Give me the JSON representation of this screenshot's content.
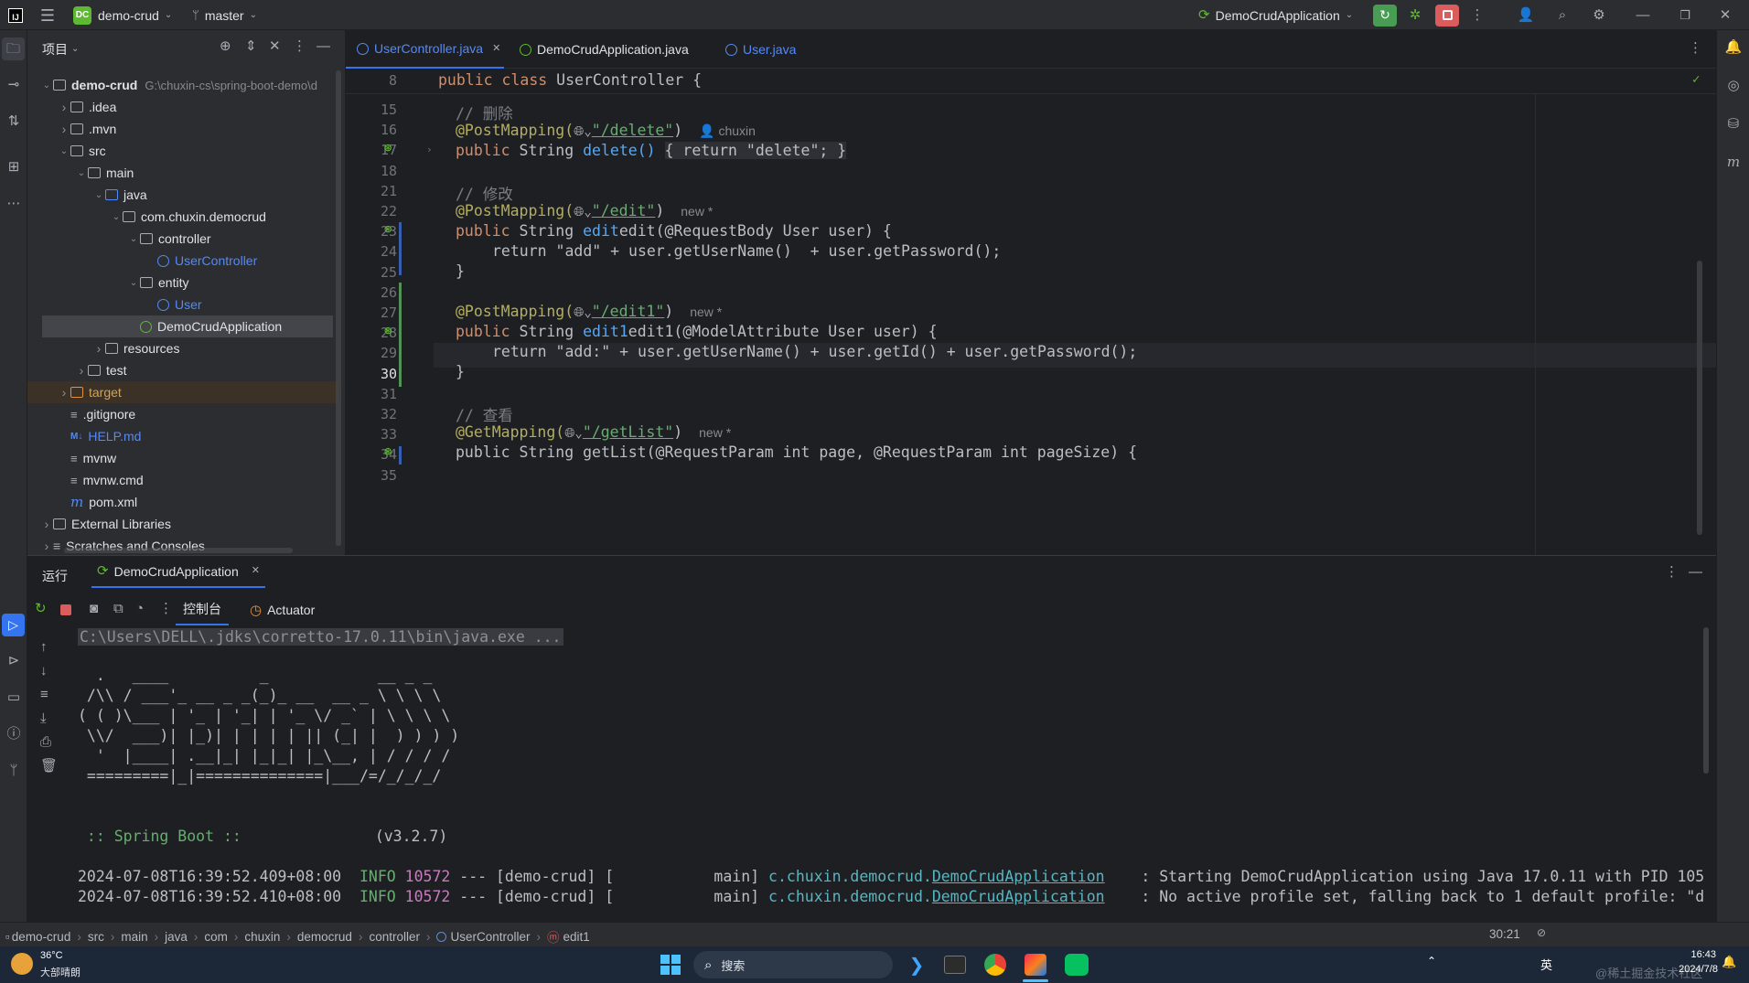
{
  "titlebar": {
    "project_badge": "DC",
    "project_name": "demo-crud",
    "branch": "master",
    "run_config": "DemoCrudApplication"
  },
  "project_panel": {
    "title": "项目",
    "items": [
      {
        "label": "demo-crud",
        "path": "G:\\chuxin-cs\\spring-boot-demo\\d",
        "depth": 0,
        "type": "module",
        "expanded": true
      },
      {
        "label": ".idea",
        "depth": 1,
        "type": "folder",
        "expanded": false
      },
      {
        "label": ".mvn",
        "depth": 1,
        "type": "folder",
        "expanded": false
      },
      {
        "label": "src",
        "depth": 1,
        "type": "folder",
        "expanded": true
      },
      {
        "label": "main",
        "depth": 2,
        "type": "folder",
        "expanded": true
      },
      {
        "label": "java",
        "depth": 3,
        "type": "source-folder",
        "expanded": true
      },
      {
        "label": "com.chuxin.democrud",
        "depth": 4,
        "type": "package",
        "expanded": true
      },
      {
        "label": "controller",
        "depth": 5,
        "type": "package",
        "expanded": true
      },
      {
        "label": "UserController",
        "depth": 6,
        "type": "class"
      },
      {
        "label": "entity",
        "depth": 5,
        "type": "package",
        "expanded": true
      },
      {
        "label": "User",
        "depth": 6,
        "type": "class"
      },
      {
        "label": "DemoCrudApplication",
        "depth": 5,
        "type": "spring-class",
        "selected": true
      },
      {
        "label": "resources",
        "depth": 3,
        "type": "folder",
        "expanded": false
      },
      {
        "label": "test",
        "depth": 2,
        "type": "folder",
        "expanded": false
      },
      {
        "label": "target",
        "depth": 1,
        "type": "excluded-folder",
        "expanded": false
      },
      {
        "label": ".gitignore",
        "depth": 1,
        "type": "file"
      },
      {
        "label": "HELP.md",
        "depth": 1,
        "type": "markdown"
      },
      {
        "label": "mvnw",
        "depth": 1,
        "type": "file"
      },
      {
        "label": "mvnw.cmd",
        "depth": 1,
        "type": "file"
      },
      {
        "label": "pom.xml",
        "depth": 1,
        "type": "maven"
      },
      {
        "label": "External Libraries",
        "depth": 0,
        "type": "library",
        "expanded": false
      },
      {
        "label": "Scratches and Consoles",
        "depth": 0,
        "type": "scratch",
        "expanded": false
      }
    ]
  },
  "editor_tabs": [
    {
      "label": "UserController.java",
      "active": true
    },
    {
      "label": "DemoCrudApplication.java",
      "active": false
    },
    {
      "label": "User.java",
      "active": false
    }
  ],
  "editor": {
    "sticky_line_no": "8",
    "sticky_line": "public class UserController {",
    "line_numbers": [
      "15",
      "16",
      "17",
      "18",
      "21",
      "22",
      "23",
      "24",
      "25",
      "26",
      "27",
      "28",
      "29",
      "30",
      "31",
      "32",
      "33",
      "34",
      "35"
    ],
    "lines": {
      "l16": "// 删除",
      "l17_ann": "@PostMapping(",
      "l17_path": "\"/delete\"",
      "l17_author": "chuxin",
      "l18_sig": "delete()",
      "l18_body": "{ return \"delete\"; }",
      "l22": "// 修改",
      "l23_path": "\"/edit\"",
      "l24_sig": "edit(@RequestBody User user) {",
      "l25": "return \"add\" + user.getUserName()  + user.getPassword();",
      "l28_path": "\"/edit1\"",
      "l29_sig": "edit1(@ModelAttribute User user) {",
      "l30": "return \"add:\" + user.getUserName() + user.getId() + user.getPassword();",
      "l33": "// 查看",
      "l34_ann": "@GetMapping(",
      "l34_path": "\"/getList\"",
      "l35": "public String getList(@RequestParam int page, @RequestParam int pageSize) {",
      "new_hint": "new *"
    }
  },
  "run_panel": {
    "title": "运行",
    "config_tab": "DemoCrudApplication",
    "console_tab": "控制台",
    "actuator_tab": "Actuator",
    "command": "C:\\Users\\DELL\\.jdks\\corretto-17.0.11\\bin\\java.exe ...",
    "banner": [
      "  .   ____          _            __ _ _",
      " /\\\\ / ___'_ __ _ _(_)_ __  __ _ \\ \\ \\ \\",
      "( ( )\\___ | '_ | '_| | '_ \\/ _` | \\ \\ \\ \\",
      " \\\\/  ___)| |_)| | | | | || (_| |  ) ) ) )",
      "  '  |____| .__|_| |_|_| |_\\__, | / / / /",
      " =========|_|==============|___/=/_/_/_/"
    ],
    "spring_boot_label": " :: Spring Boot ::",
    "spring_boot_version": "(v3.2.7)",
    "log1_time": "2024-07-08T16:39:52.409+08:00",
    "log1_level": "INFO",
    "log1_pid": "10572",
    "log1_mid": "--- [demo-crud] [           main]",
    "log1_logger": "c.chuxin.democrud.",
    "log1_logger_link": "DemoCrudApplication",
    "log1_msg": ": Starting DemoCrudApplication using Java 17.0.11 with PID 105",
    "log2_time": "2024-07-08T16:39:52.410+08:00",
    "log2_level": "INFO",
    "log2_pid": "10572",
    "log2_mid": "--- [demo-crud] [           main]",
    "log2_logger": "c.chuxin.democrud.",
    "log2_logger_link": "DemoCrudApplication",
    "log2_msg": ": No active profile set, falling back to 1 default profile: \"d"
  },
  "statusbar": {
    "breadcrumb": [
      "demo-crud",
      "src",
      "main",
      "java",
      "com",
      "chuxin",
      "democrud",
      "controller",
      "UserController",
      "edit1"
    ],
    "position": "30:21",
    "ime": "英"
  },
  "taskbar": {
    "weather_temp": "36°C",
    "weather_desc": "大部晴朗",
    "search": "搜索",
    "tray_lang": "英",
    "time": "16:43",
    "date": "2024/7/8",
    "watermark": "@稀土掘金技术社区"
  },
  "colors": {
    "accent": "#3574f0",
    "run_green": "#499c54",
    "stop_red": "#db5c5c"
  }
}
